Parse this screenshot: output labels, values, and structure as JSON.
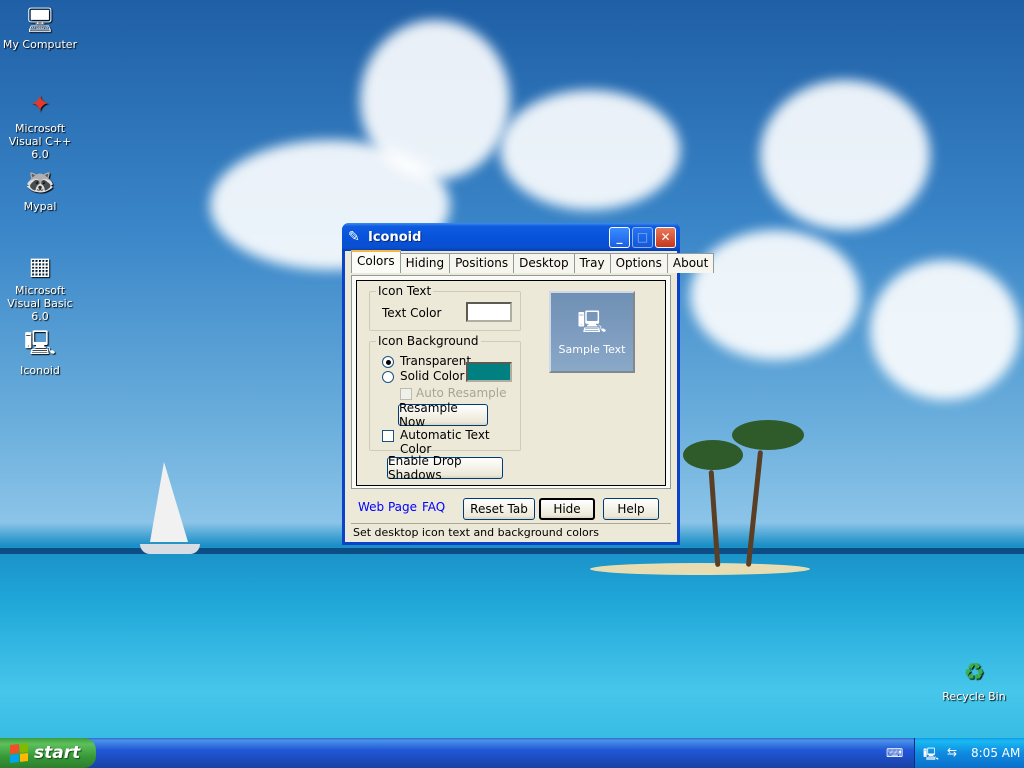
{
  "desktop": {
    "icons": [
      {
        "label": "My Computer",
        "icon": "computer-icon"
      },
      {
        "label": "Microsoft Visual C++ 6.0",
        "icon": "vc-icon"
      },
      {
        "label": "Mypal",
        "icon": "mypal-icon"
      },
      {
        "label": "Microsoft Visual Basic 6.0",
        "icon": "vb-icon"
      },
      {
        "label": "Iconoid",
        "icon": "iconoid-icon"
      },
      {
        "label": "Recycle Bin",
        "icon": "recycle-bin-icon"
      }
    ]
  },
  "window": {
    "title": "Iconoid",
    "tabs": [
      "Colors",
      "Hiding",
      "Positions",
      "Desktop",
      "Tray",
      "Options",
      "About"
    ],
    "active_tab": "Colors",
    "icon_text": {
      "legend": "Icon Text",
      "text_color_label": "Text Color",
      "text_color": "#ffffff"
    },
    "icon_background": {
      "legend": "Icon Background",
      "transparent_label": "Transparent",
      "solid_color_label": "Solid Color",
      "solid_color": "#008080",
      "selected": "Transparent",
      "auto_resample_label": "Auto Resample",
      "resample_now_label": "Resample Now",
      "automatic_text_color_label": "Automatic Text Color"
    },
    "preview": {
      "label": "Sample Text"
    },
    "enable_drop_shadows_label": "Enable Drop Shadows",
    "footer": {
      "web_page_link": "Web Page",
      "faq_link": "FAQ",
      "reset_tab_label": "Reset Tab",
      "hide_label": "Hide",
      "help_label": "Help"
    },
    "status_text": "Set desktop icon text and background colors"
  },
  "taskbar": {
    "start_label": "start",
    "clock": "8:05 AM"
  },
  "colors": {
    "title_bar": "#0753da",
    "start_button": "#3c9c3c",
    "teal_swatch": "#008080"
  }
}
